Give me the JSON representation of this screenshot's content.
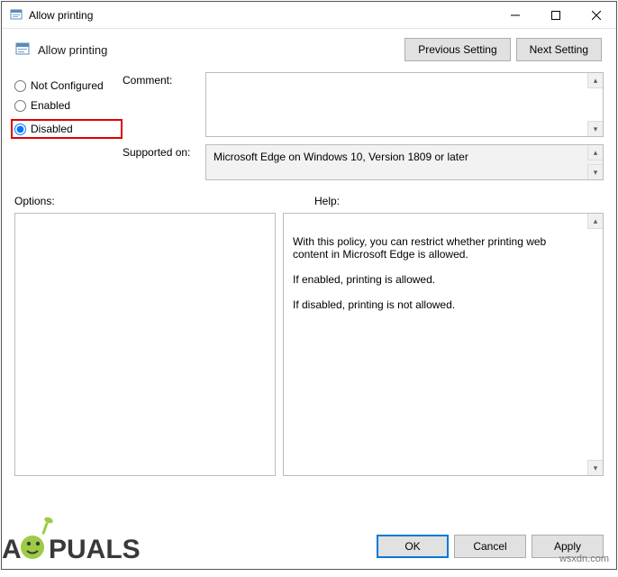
{
  "window": {
    "title": "Allow printing"
  },
  "header": {
    "title": "Allow printing"
  },
  "nav": {
    "previous": "Previous Setting",
    "next": "Next Setting"
  },
  "state": {
    "not_configured": "Not Configured",
    "enabled": "Enabled",
    "disabled": "Disabled",
    "selected": "disabled"
  },
  "comment": {
    "label": "Comment:",
    "value": ""
  },
  "supported": {
    "label": "Supported on:",
    "value": "Microsoft Edge on Windows 10, Version 1809 or later"
  },
  "sections": {
    "options": "Options:",
    "help": "Help:"
  },
  "help_text": "With this policy, you can restrict whether printing web content in Microsoft Edge is allowed.\n\nIf enabled, printing is allowed.\n\nIf disabled, printing is not allowed.",
  "buttons": {
    "ok": "OK",
    "cancel": "Cancel",
    "apply": "Apply"
  },
  "watermark": {
    "brand": "APPUALS",
    "site": "wsxdn.com"
  }
}
